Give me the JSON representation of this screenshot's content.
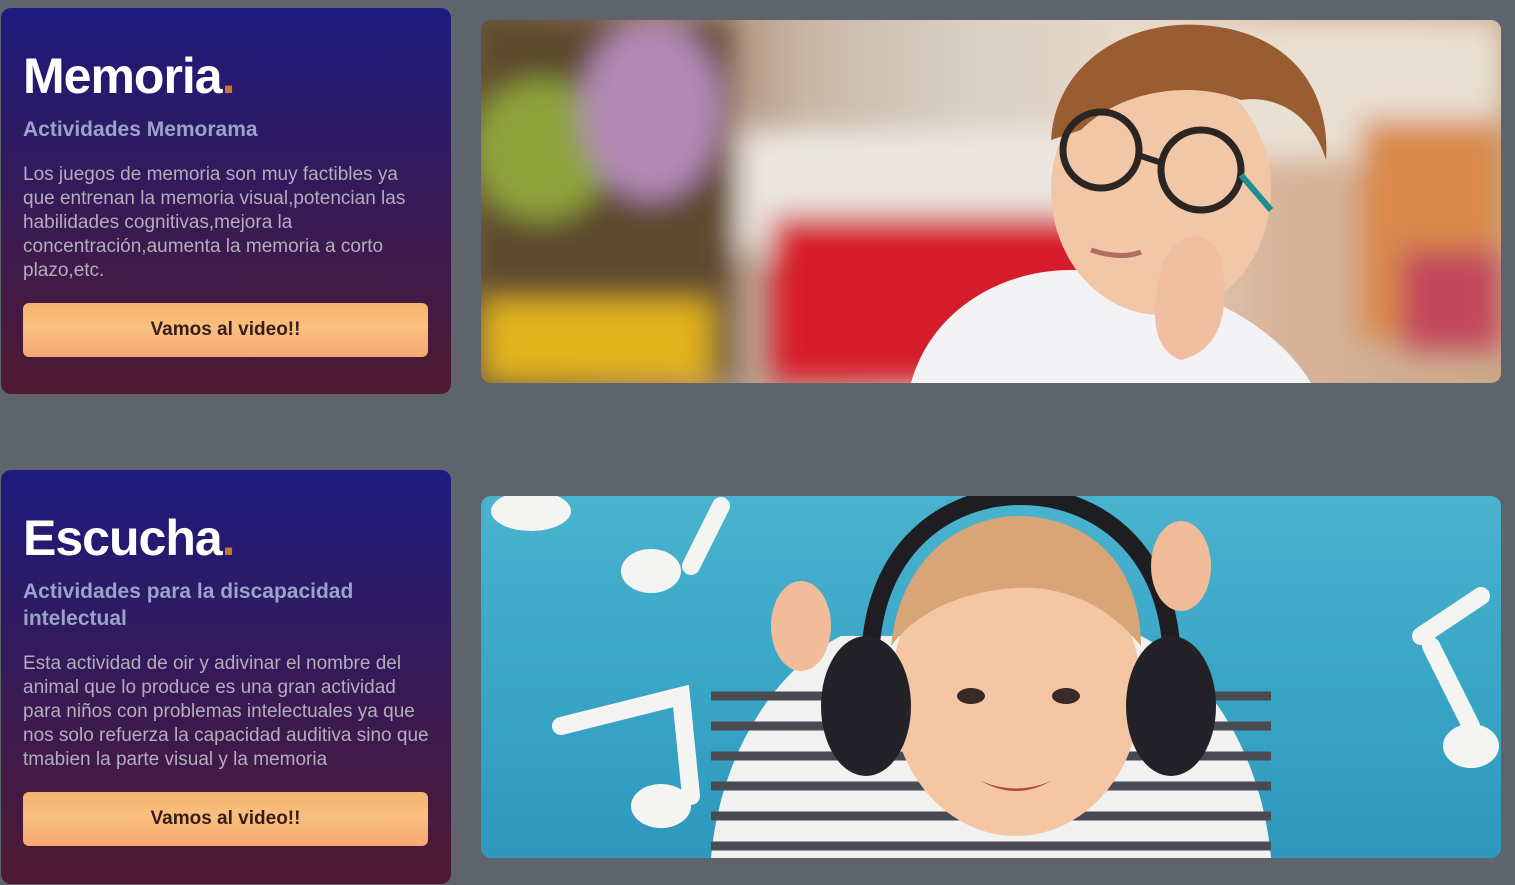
{
  "cards": [
    {
      "title": "Memoria",
      "title_dot": ".",
      "subtitle": "Actividades Memorama",
      "description": "Los juegos de memoria son muy factibles ya que entrenan la memoria visual,potencian las habilidades cognitivas,mejora la concentración,aumenta la memoria a corto plazo,etc.",
      "button_label": "Vamos al video!!"
    },
    {
      "title": "Escucha",
      "title_dot": ".",
      "subtitle": "Actividades para la discapacidad intelectual",
      "description": "Esta actividad de oir y adivinar el nombre del animal que lo produce es una gran actividad para niños con problemas intelectuales ya que nos solo refuerza la capacidad auditiva sino que tmabien la parte visual y la memoria",
      "button_label": "Vamos al video!!"
    }
  ],
  "colors": {
    "page_background": "#5f636c",
    "card_gradient_top": "#1c1b7f",
    "card_gradient_bottom": "#4f1a30",
    "accent_dot": "#c9772f",
    "button": "#f7b877"
  }
}
